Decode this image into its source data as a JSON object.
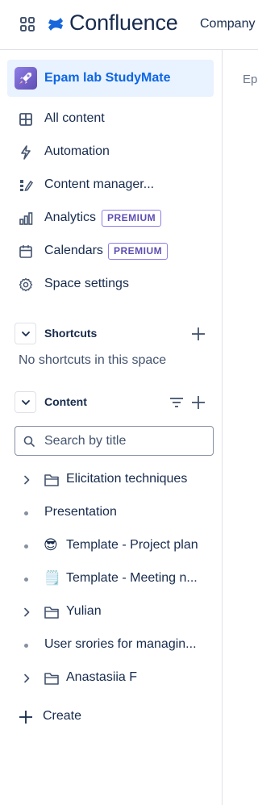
{
  "header": {
    "logo_text": "Confluence",
    "nav_item": "Company"
  },
  "main": {
    "breadcrumb": "Epa"
  },
  "sidebar": {
    "space": {
      "name": "Epam lab StudyMate",
      "avatar_color": "#6e5dc6"
    },
    "nav": [
      {
        "label": "All content",
        "icon": "grid-icon"
      },
      {
        "label": "Automation",
        "icon": "lightning-icon"
      },
      {
        "label": "Content manager...",
        "icon": "content-manager-icon"
      },
      {
        "label": "Analytics",
        "icon": "bar-chart-icon",
        "badge": "PREMIUM"
      },
      {
        "label": "Calendars",
        "icon": "calendar-icon",
        "badge": "PREMIUM"
      },
      {
        "label": "Space settings",
        "icon": "gear-icon"
      }
    ],
    "shortcuts": {
      "title": "Shortcuts",
      "empty_text": "No shortcuts in this space"
    },
    "content": {
      "title": "Content",
      "search_placeholder": "Search by title",
      "items": [
        {
          "label": "Elicitation techniques",
          "type": "folder",
          "expandable": true
        },
        {
          "label": "Presentation",
          "type": "page",
          "expandable": false
        },
        {
          "label": "Template - Project plan",
          "type": "page",
          "emoji": "😎",
          "expandable": false
        },
        {
          "label": "Template - Meeting n...",
          "type": "page",
          "emoji": "🗒️",
          "expandable": false
        },
        {
          "label": "Yulian",
          "type": "folder",
          "expandable": true
        },
        {
          "label": "User srories for managin...",
          "type": "page",
          "expandable": false
        },
        {
          "label": "Anastasiia F",
          "type": "folder",
          "expandable": true
        }
      ]
    },
    "create_label": "Create"
  },
  "colors": {
    "accent": "#0c66e4",
    "selected_bg": "#e9f2ff",
    "premium_border": "#8f7ee7",
    "premium_text": "#5e4db2",
    "text": "#172b4d"
  }
}
